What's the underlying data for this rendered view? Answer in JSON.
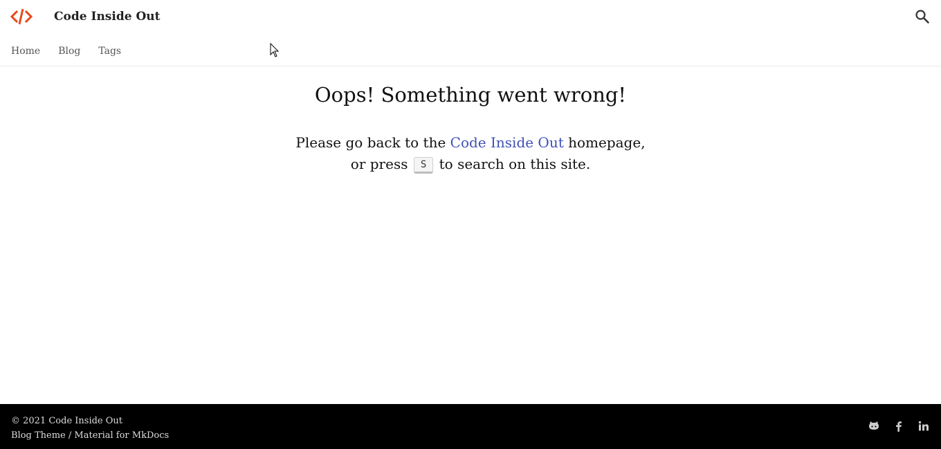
{
  "header": {
    "title": "Code Inside Out",
    "logo_icon": "code-brackets-icon",
    "search_icon": "search-icon",
    "accent_color": "#e64a19"
  },
  "nav": {
    "items": [
      {
        "label": "Home"
      },
      {
        "label": "Blog"
      },
      {
        "label": "Tags"
      }
    ]
  },
  "main": {
    "heading": "Oops! Something went wrong!",
    "line1_before": "Please go back to the ",
    "link_text": "Code Inside Out",
    "line1_after": " homepage,",
    "line2_before": "or press ",
    "key": "S",
    "line2_after": " to search on this site.",
    "link_color": "#3f51b5"
  },
  "footer": {
    "copyright": "© 2021 Code Inside Out",
    "theme_link": "Blog Theme",
    "separator": " / ",
    "material_link": "Material for MkDocs",
    "social_icons": [
      "github-icon",
      "facebook-icon",
      "linkedin-icon"
    ]
  }
}
